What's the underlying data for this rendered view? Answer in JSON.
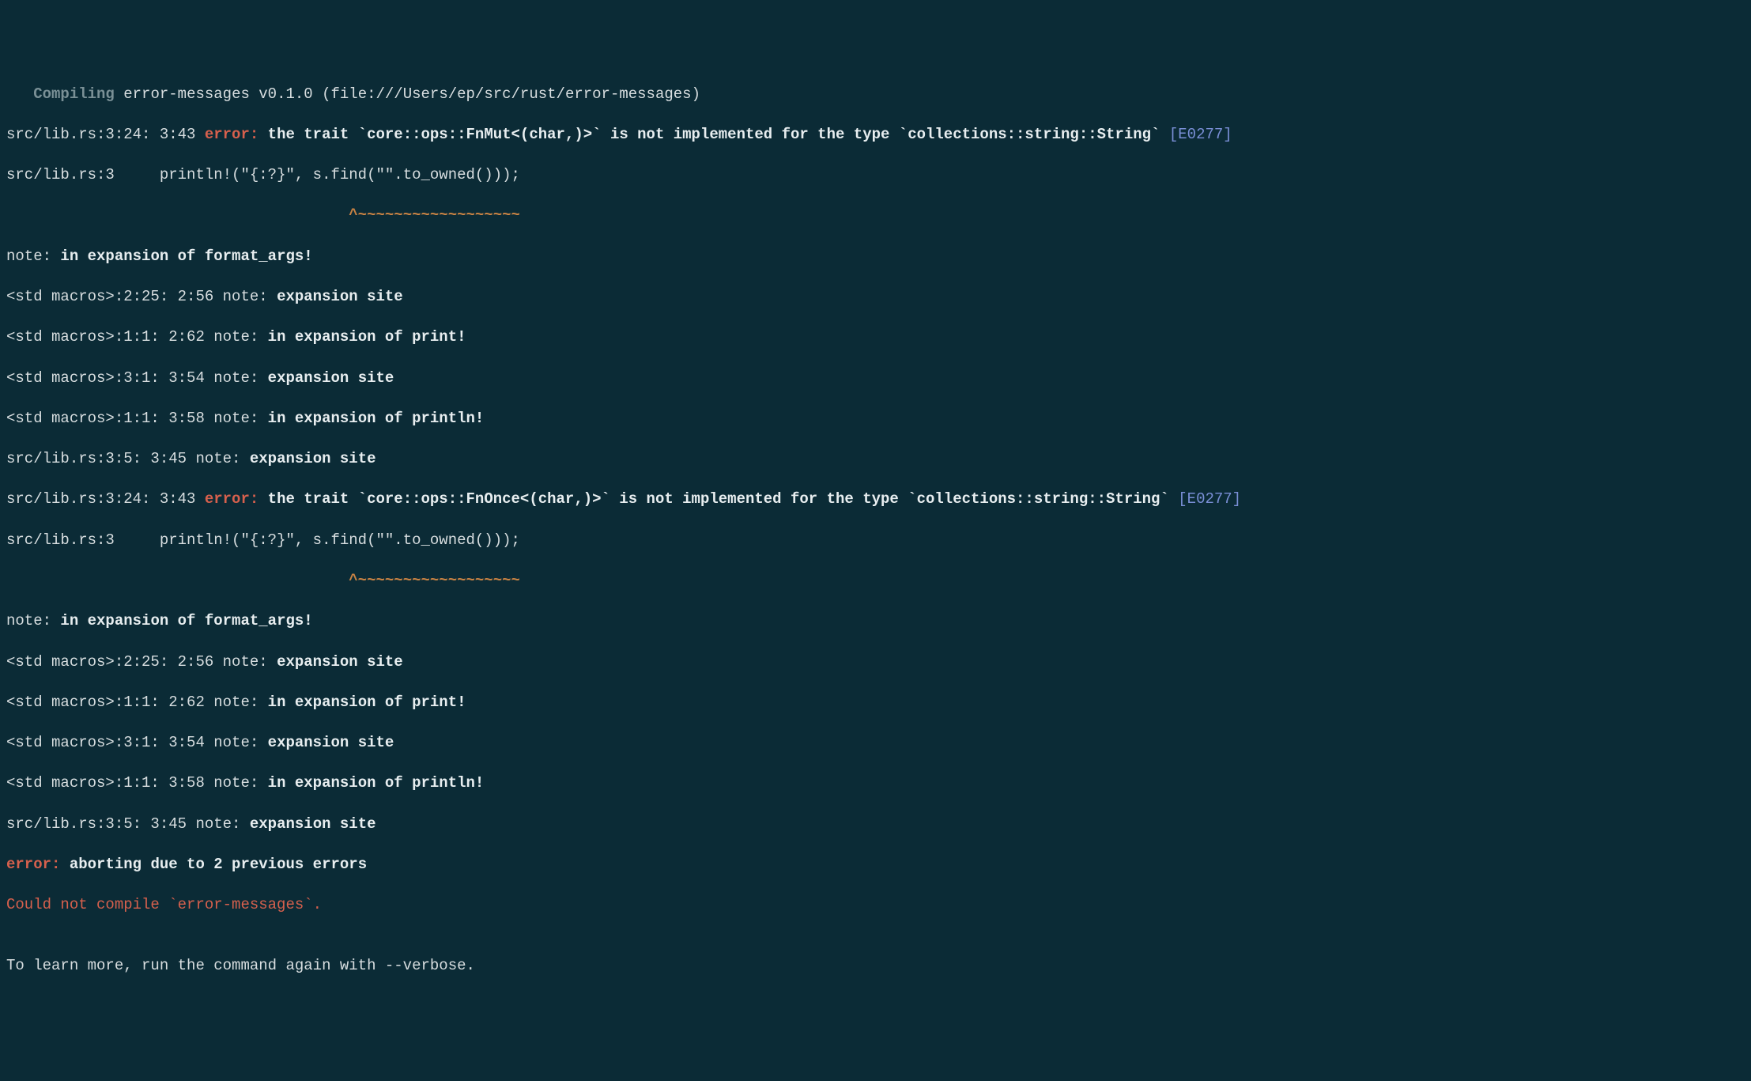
{
  "compiling": {
    "label": "Compiling",
    "package": "error-messages v0.1.0 (file:///Users/ep/src/rust/error-messages)"
  },
  "err1": {
    "loc": "src/lib.rs:3:24: 3:43 ",
    "tag": "error: ",
    "msg1": "the trait `core::ops::FnMut<(char,)>` is not implemented for the type `collections::string::String` ",
    "code": "[E0277]",
    "srcline_loc": "src/lib.rs:3     ",
    "srcline": "println!(\"{:?}\", s.find(\"\".to_owned()));",
    "caret_pad": "                                      ",
    "caret": "^~~~~~~~~~~~~~~~~~~"
  },
  "note1": {
    "tag": "note: ",
    "msg": "in expansion of format_args!"
  },
  "trace1": [
    {
      "loc": "<std macros>:2:25: 2:56 ",
      "tag": "note: ",
      "msg": "expansion site"
    },
    {
      "loc": "<std macros>:1:1: 2:62 ",
      "tag": "note: ",
      "msg": "in expansion of print!"
    },
    {
      "loc": "<std macros>:3:1: 3:54 ",
      "tag": "note: ",
      "msg": "expansion site"
    },
    {
      "loc": "<std macros>:1:1: 3:58 ",
      "tag": "note: ",
      "msg": "in expansion of println!"
    },
    {
      "loc": "src/lib.rs:3:5: 3:45 ",
      "tag": "note: ",
      "msg": "expansion site"
    }
  ],
  "err2": {
    "loc": "src/lib.rs:3:24: 3:43 ",
    "tag": "error: ",
    "msg1": "the trait `core::ops::FnOnce<(char,)>` is not implemented for the type `collections::string::String` ",
    "code": "[E0277]",
    "srcline_loc": "src/lib.rs:3     ",
    "srcline": "println!(\"{:?}\", s.find(\"\".to_owned()));",
    "caret_pad": "                                      ",
    "caret": "^~~~~~~~~~~~~~~~~~~"
  },
  "note2": {
    "tag": "note: ",
    "msg": "in expansion of format_args!"
  },
  "trace2": [
    {
      "loc": "<std macros>:2:25: 2:56 ",
      "tag": "note: ",
      "msg": "expansion site"
    },
    {
      "loc": "<std macros>:1:1: 2:62 ",
      "tag": "note: ",
      "msg": "in expansion of print!"
    },
    {
      "loc": "<std macros>:3:1: 3:54 ",
      "tag": "note: ",
      "msg": "expansion site"
    },
    {
      "loc": "<std macros>:1:1: 3:58 ",
      "tag": "note: ",
      "msg": "in expansion of println!"
    },
    {
      "loc": "src/lib.rs:3:5: 3:45 ",
      "tag": "note: ",
      "msg": "expansion site"
    }
  ],
  "abort": {
    "tag": "error: ",
    "msg": "aborting due to 2 previous errors"
  },
  "fail": "Could not compile `error-messages`.",
  "blank": "",
  "learn": "To learn more, run the command again with --verbose."
}
